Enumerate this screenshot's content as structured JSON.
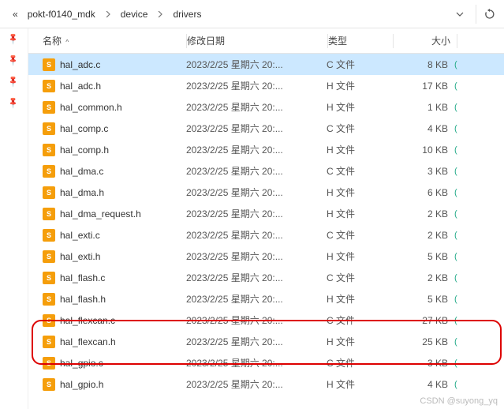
{
  "breadcrumb": {
    "prefix": "«",
    "items": [
      "pokt-f0140_mdk",
      "device",
      "drivers"
    ]
  },
  "headers": {
    "name": "名称",
    "date": "修改日期",
    "type": "类型",
    "size": "大小"
  },
  "files": [
    {
      "name": "hal_adc.c",
      "date": "2023/2/25 星期六 20:...",
      "type": "C 文件",
      "size": "8 KB",
      "sel": true
    },
    {
      "name": "hal_adc.h",
      "date": "2023/2/25 星期六 20:...",
      "type": "H 文件",
      "size": "17 KB"
    },
    {
      "name": "hal_common.h",
      "date": "2023/2/25 星期六 20:...",
      "type": "H 文件",
      "size": "1 KB"
    },
    {
      "name": "hal_comp.c",
      "date": "2023/2/25 星期六 20:...",
      "type": "C 文件",
      "size": "4 KB"
    },
    {
      "name": "hal_comp.h",
      "date": "2023/2/25 星期六 20:...",
      "type": "H 文件",
      "size": "10 KB"
    },
    {
      "name": "hal_dma.c",
      "date": "2023/2/25 星期六 20:...",
      "type": "C 文件",
      "size": "3 KB"
    },
    {
      "name": "hal_dma.h",
      "date": "2023/2/25 星期六 20:...",
      "type": "H 文件",
      "size": "6 KB"
    },
    {
      "name": "hal_dma_request.h",
      "date": "2023/2/25 星期六 20:...",
      "type": "H 文件",
      "size": "2 KB"
    },
    {
      "name": "hal_exti.c",
      "date": "2023/2/25 星期六 20:...",
      "type": "C 文件",
      "size": "2 KB"
    },
    {
      "name": "hal_exti.h",
      "date": "2023/2/25 星期六 20:...",
      "type": "H 文件",
      "size": "5 KB"
    },
    {
      "name": "hal_flash.c",
      "date": "2023/2/25 星期六 20:...",
      "type": "C 文件",
      "size": "2 KB"
    },
    {
      "name": "hal_flash.h",
      "date": "2023/2/25 星期六 20:...",
      "type": "H 文件",
      "size": "5 KB"
    },
    {
      "name": "hal_flexcan.c",
      "date": "2023/2/25 星期六 20:...",
      "type": "C 文件",
      "size": "27 KB"
    },
    {
      "name": "hal_flexcan.h",
      "date": "2023/2/25 星期六 20:...",
      "type": "H 文件",
      "size": "25 KB"
    },
    {
      "name": "hal_gpio.c",
      "date": "2023/2/25 星期六 20:...",
      "type": "C 文件",
      "size": "3 KB"
    },
    {
      "name": "hal_gpio.h",
      "date": "2023/2/25 星期六 20:...",
      "type": "H 文件",
      "size": "4 KB"
    }
  ],
  "watermark": "CSDN @suyong_yq"
}
